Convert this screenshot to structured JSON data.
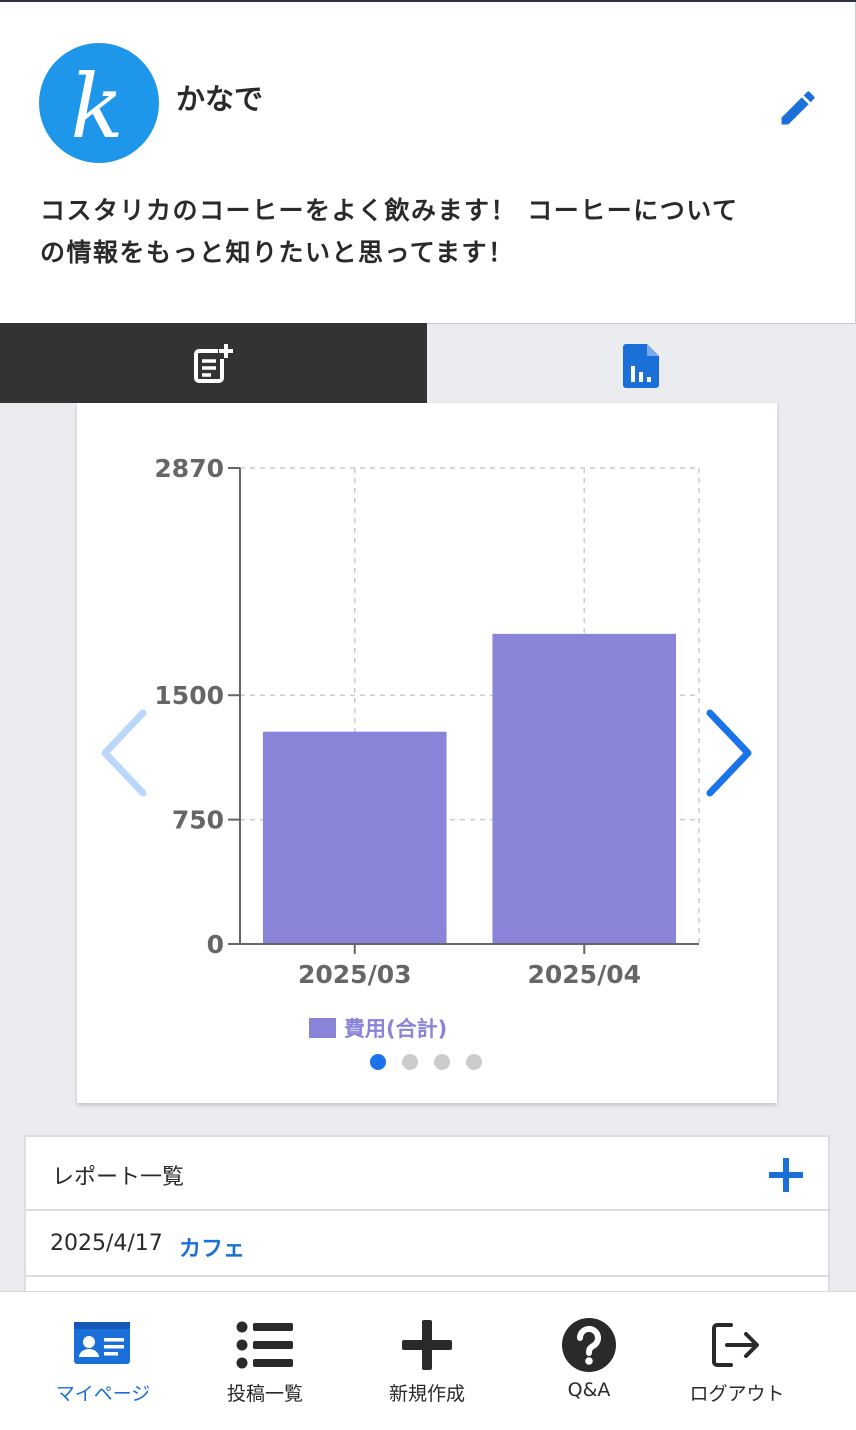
{
  "profile": {
    "avatar_letter": "k",
    "username": "かなで",
    "bio_line1": "コスタリカのコーヒーをよく飲みます！ コーヒーについて",
    "bio_line2": "の情報をもっと知りたいと思ってます！"
  },
  "tabs": [
    {
      "icon": "post-add-icon",
      "active": true
    },
    {
      "icon": "report-chart-icon",
      "active": false
    }
  ],
  "chart_data": {
    "type": "bar",
    "categories": [
      "2025/03",
      "2025/04"
    ],
    "series": [
      {
        "name": "費用(合計)",
        "values": [
          1280,
          1870
        ],
        "color": "#8984d8"
      }
    ],
    "yticks": [
      0,
      750,
      1500,
      2870
    ],
    "ylim": [
      0,
      2870
    ],
    "grid": true,
    "legend": "bottom"
  },
  "carousel": {
    "page_count": 4,
    "active_index": 0
  },
  "reports": {
    "title": "レポート一覧",
    "rows": [
      {
        "date": "2025/4/17",
        "category": "カフェ"
      }
    ]
  },
  "bottom_nav": [
    {
      "label": "マイページ",
      "icon": "id-card-icon",
      "active": true
    },
    {
      "label": "投稿一覧",
      "icon": "list-icon",
      "active": false
    },
    {
      "label": "新規作成",
      "icon": "plus-icon",
      "active": false
    },
    {
      "label": "Q&A",
      "icon": "question-icon",
      "active": false
    },
    {
      "label": "ログアウト",
      "icon": "logout-icon",
      "active": false
    }
  ],
  "colors": {
    "accent": "#1a73e8",
    "bar": "#8984d8",
    "avatar_bg": "#1e97ea",
    "tab_active_bg": "#333333"
  }
}
